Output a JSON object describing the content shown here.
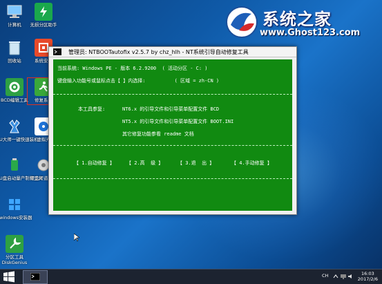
{
  "desktop": {
    "icons": [
      {
        "name": "computer-icon",
        "label": "计算机"
      },
      {
        "name": "partition-helper-icon",
        "label": "无损分区助手"
      },
      {
        "name": "recycle-bin-icon",
        "label": "回收站"
      },
      {
        "name": "system-install-icon",
        "label": "系统安装"
      },
      {
        "name": "bcd-editor-icon",
        "label": "BCD编辑工具"
      },
      {
        "name": "repair-system-icon",
        "label": "修复系统"
      },
      {
        "name": "one-key-install-icon",
        "label": "U大师一键快速装机"
      },
      {
        "name": "virtual-disk-icon",
        "label": "虚拟光"
      },
      {
        "name": "u-disk-tool-icon",
        "label": "U盘启动量产制作工具"
      },
      {
        "name": "disk-repair-icon",
        "label": "硬盘坏道工具"
      },
      {
        "name": "windows-install-icon",
        "label": "windows安装器"
      },
      {
        "name": "diskgenius-icon",
        "label": "分区工具DiskGenius"
      }
    ]
  },
  "logo": {
    "text": "系统之家",
    "url": "www.Ghost123.com"
  },
  "window": {
    "title": "管理员: NTBOOTautofix v2.5.7 by chz_hlh - NT系统引导自动修复工具",
    "console": {
      "current_system": "当前系统: Windows PE - 版本 6.2.9200  ( 活动分区 - C: )",
      "prompt": "键盘输入功能号或鼠标点击【 】内选择:          ( 区域 = zh-CN )",
      "ref_intro": "本工具参复:",
      "ref_nt6": "NT6.x 的引导文件和引导菜单配置文件 BCD",
      "ref_nt5": "NT5.x 的引导文件和引导菜单配置文件 BOOT.INI",
      "ref_other": "其它修复功能参看 readme 文档",
      "menu": {
        "auto": "【 1.自动修复 】",
        "advanced": "【 2.高  级 】",
        "exit": "【 3.退  出 】",
        "manual": "【 4.手动修复 】"
      }
    }
  },
  "taskbar": {
    "tray_lang": "CH",
    "time": "16:03",
    "date": "2017/2/6"
  }
}
